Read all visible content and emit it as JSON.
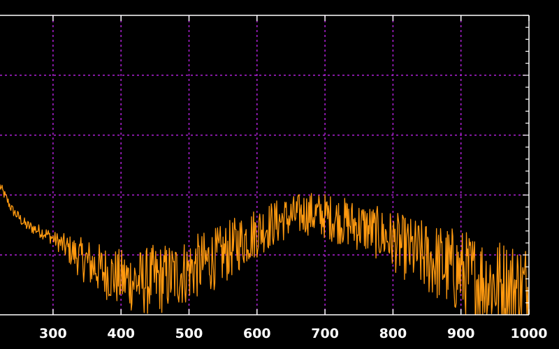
{
  "chart_data": {
    "type": "line",
    "title": "",
    "xlabel": "",
    "ylabel": "",
    "xlim": [
      222,
      1000
    ],
    "ylim": [
      0,
      5
    ],
    "x_ticks": [
      300,
      400,
      500,
      600,
      700,
      800,
      900,
      1000
    ],
    "x_tick_labels": [
      "300",
      "400",
      "500",
      "600",
      "700",
      "800",
      "900",
      "1000"
    ],
    "y_grid": [
      1,
      2,
      3,
      4
    ],
    "grid": true,
    "legend": "none",
    "colors": {
      "background": "#000000",
      "axis": "#ffffff",
      "grid": "#b020d8",
      "series": "#ff9a10"
    },
    "series": [
      {
        "x_start": 222,
        "x_end": 1000,
        "x_step": 1,
        "trend": [
          [
            222,
            2.15
          ],
          [
            240,
            1.75
          ],
          [
            260,
            1.5
          ],
          [
            290,
            1.35
          ],
          [
            310,
            1.2
          ],
          [
            340,
            0.95
          ],
          [
            370,
            0.75
          ],
          [
            400,
            0.6
          ],
          [
            430,
            0.55
          ],
          [
            460,
            0.6
          ],
          [
            490,
            0.7
          ],
          [
            520,
            0.85
          ],
          [
            550,
            1.0
          ],
          [
            580,
            1.25
          ],
          [
            610,
            1.45
          ],
          [
            640,
            1.6
          ],
          [
            670,
            1.7
          ],
          [
            700,
            1.65
          ],
          [
            730,
            1.55
          ],
          [
            760,
            1.45
          ],
          [
            790,
            1.3
          ],
          [
            820,
            1.1
          ],
          [
            850,
            0.95
          ],
          [
            880,
            0.8
          ],
          [
            910,
            0.65
          ],
          [
            940,
            0.55
          ],
          [
            970,
            0.45
          ],
          [
            1000,
            0.4
          ]
        ],
        "noise": [
          [
            222,
            0.08
          ],
          [
            300,
            0.12
          ],
          [
            350,
            0.4
          ],
          [
            450,
            0.6
          ],
          [
            560,
            0.5
          ],
          [
            650,
            0.35
          ],
          [
            780,
            0.45
          ],
          [
            900,
            0.75
          ],
          [
            1000,
            0.85
          ]
        ]
      }
    ]
  }
}
